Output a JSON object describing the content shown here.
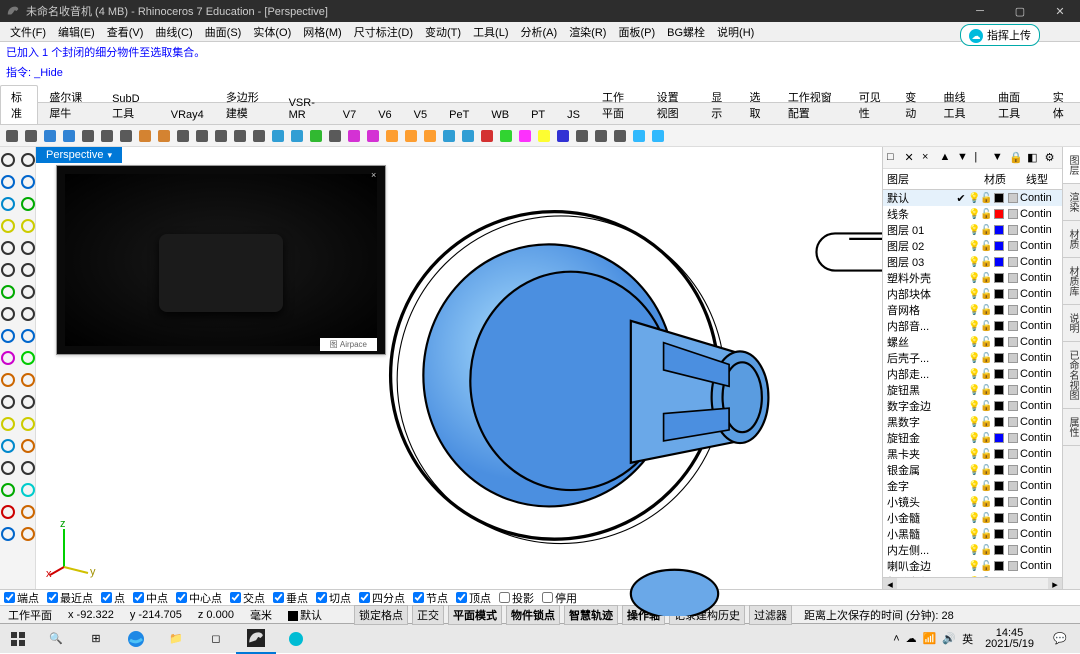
{
  "window": {
    "title": "未命名收音机 (4 MB) - Rhinoceros 7 Education - [Perspective]"
  },
  "menu": [
    "文件(F)",
    "编辑(E)",
    "查看(V)",
    "曲线(C)",
    "曲面(S)",
    "实体(O)",
    "网格(M)",
    "尺寸标注(D)",
    "变动(T)",
    "工具(L)",
    "分析(A)",
    "渲染(R)",
    "面板(P)",
    "BG螺栓",
    "说明(H)"
  ],
  "pill": "指挥上传",
  "cmdhist1": "已加入 1 个封闭的细分物件至选取集合。",
  "cmdhist2": "指令: _Hide",
  "cmdprompt": "指令:",
  "tabs": [
    "标准",
    "盛尔课犀牛",
    "SubD工具",
    "VRay4",
    "多边形建模",
    "VSR-MR",
    "V7",
    "V6",
    "V5",
    "PeT",
    "WB",
    "PT",
    "JS",
    "工作平面",
    "设置视图",
    "显示",
    "选取",
    "工作视窗配置",
    "可见性",
    "变动",
    "曲线工具",
    "曲面工具",
    "实体"
  ],
  "viewport_tab": "Perspective",
  "ref_label": "图 Airpace",
  "layers_header": {
    "name": "图层",
    "mat": "材质",
    "lt": "线型"
  },
  "layers": [
    {
      "name": "默认",
      "active": true,
      "check": true,
      "color": "#000",
      "lt": "Contin"
    },
    {
      "name": "线条",
      "color": "#f00",
      "lt": "Contin"
    },
    {
      "name": "图层 01",
      "color": "#00f",
      "lt": "Contin"
    },
    {
      "name": "图层 02",
      "color": "#00f",
      "lt": "Contin"
    },
    {
      "name": "图层 03",
      "color": "#00f",
      "lt": "Contin"
    },
    {
      "name": "塑料外壳",
      "color": "#000",
      "lt": "Contin"
    },
    {
      "name": "内部块体",
      "color": "#000",
      "lt": "Contin"
    },
    {
      "name": "音网格",
      "color": "#000",
      "lt": "Contin"
    },
    {
      "name": "内部音...",
      "color": "#000",
      "lt": "Contin"
    },
    {
      "name": "螺丝",
      "color": "#000",
      "lt": "Contin"
    },
    {
      "name": "后壳子...",
      "color": "#000",
      "lt": "Contin"
    },
    {
      "name": "内部走...",
      "color": "#000",
      "lt": "Contin"
    },
    {
      "name": "旋钮黑",
      "color": "#000",
      "lt": "Contin"
    },
    {
      "name": "数字金边",
      "color": "#000",
      "lt": "Contin"
    },
    {
      "name": "黑数字",
      "color": "#000",
      "lt": "Contin"
    },
    {
      "name": "旋钮金",
      "color": "#00f",
      "lt": "Contin"
    },
    {
      "name": "黑卡夹",
      "color": "#000",
      "lt": "Contin"
    },
    {
      "name": "银金属",
      "color": "#000",
      "lt": "Contin"
    },
    {
      "name": "金字",
      "color": "#000",
      "lt": "Contin"
    },
    {
      "name": "小镜头",
      "color": "#000",
      "lt": "Contin"
    },
    {
      "name": "小金髓",
      "color": "#000",
      "lt": "Contin"
    },
    {
      "name": "小黑髓",
      "color": "#000",
      "lt": "Contin"
    },
    {
      "name": "内左侧...",
      "color": "#000",
      "lt": "Contin"
    },
    {
      "name": "喇叭金边",
      "color": "#000",
      "lt": "Contin"
    },
    {
      "name": "细分备份",
      "color": "#000",
      "lt": "Contin"
    }
  ],
  "rightdock": [
    "图层",
    "渲染",
    "材质",
    "材质库",
    "说明",
    "已命名视图",
    "属性"
  ],
  "snaps": [
    {
      "label": "端点",
      "on": true
    },
    {
      "label": "最近点",
      "on": true
    },
    {
      "label": "点",
      "on": true
    },
    {
      "label": "中点",
      "on": true
    },
    {
      "label": "中心点",
      "on": true
    },
    {
      "label": "交点",
      "on": true
    },
    {
      "label": "垂点",
      "on": true
    },
    {
      "label": "切点",
      "on": true
    },
    {
      "label": "四分点",
      "on": true
    },
    {
      "label": "节点",
      "on": true
    },
    {
      "label": "顶点",
      "on": true
    },
    {
      "label": "投影",
      "on": false
    },
    {
      "label": "停用",
      "on": false
    }
  ],
  "status": {
    "cplane": "工作平面",
    "x": "x -92.322",
    "y": "y -214.705",
    "z": "z 0.000",
    "unit": "毫米",
    "layer": "默认",
    "msgs": [
      "锁定格点",
      "正交",
      "平面模式",
      "物件锁点",
      "智慧轨迹",
      "操作轴",
      "记录建构历史",
      "过滤器"
    ],
    "autosave": "距离上次保存的时间 (分钟): 28"
  },
  "taskbar": {
    "time": "14:45",
    "date": "2021/5/19"
  }
}
